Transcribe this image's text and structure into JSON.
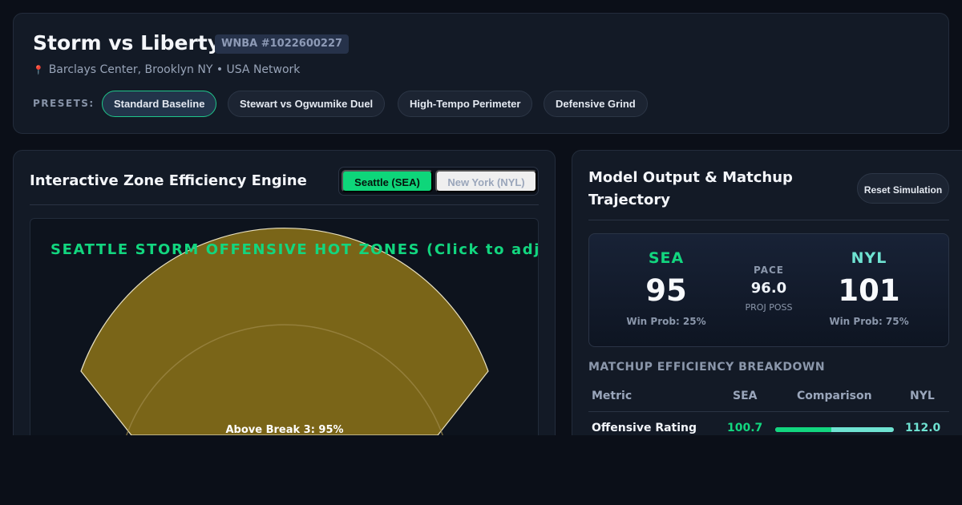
{
  "header": {
    "title": "Storm vs Liberty",
    "game_id": "WNBA #1022600227",
    "venue": "Barclays Center, Brooklyn NY • USA Network",
    "venue_icon": "map-pin-icon",
    "presets_label": "PRESETS:",
    "presets": [
      {
        "label": "Standard Baseline",
        "active": true
      },
      {
        "label": "Stewart vs Ogwumike Duel",
        "active": false
      },
      {
        "label": "High-Tempo Perimeter",
        "active": false
      },
      {
        "label": "Defensive Grind",
        "active": false
      }
    ]
  },
  "zone_engine": {
    "title": "Interactive Zone Efficiency Engine",
    "team_options": [
      "Seattle (SEA)",
      "New York (NYL)"
    ],
    "selected_team": "Seattle (SEA)",
    "court_heading": "SEATTLE STORM OFFENSIVE HOT ZONES (Click to adjus",
    "zone_label": "Above Break 3: 95%",
    "zone_value_pct": 95,
    "colors": {
      "zone_fill": "#7a6518",
      "heading": "#12d67f",
      "accent": "#0ed67a"
    }
  },
  "model_output": {
    "title": "Model Output & Matchup Trajectory",
    "reset_label": "Reset Simulation",
    "sea": {
      "abbr": "SEA",
      "score": "95",
      "win_prob": "Win Prob: 25%"
    },
    "nyl": {
      "abbr": "NYL",
      "score": "101",
      "win_prob": "Win Prob: 75%"
    },
    "pace": {
      "label": "PACE",
      "value": "96.0",
      "sub": "PROJ POSS"
    },
    "breakdown_title": "MATCHUP EFFICIENCY BREAKDOWN",
    "columns": [
      "Metric",
      "SEA",
      "Comparison",
      "NYL"
    ],
    "rows": [
      {
        "metric": "Offensive Rating",
        "sea": "100.7",
        "nyl": "112.0",
        "sea_share": 0.473
      }
    ],
    "colors": {
      "sea": "#12d67f",
      "nyl": "#6fe3d2"
    }
  }
}
